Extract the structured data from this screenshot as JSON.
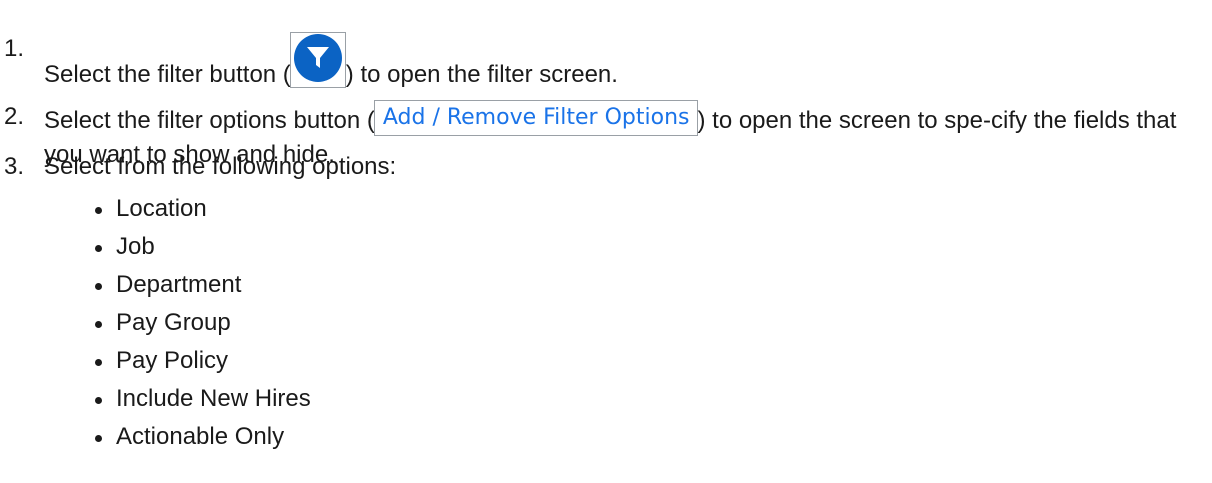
{
  "steps": [
    {
      "number": "1.",
      "before": "Select the filter button (",
      "after": ") to open the filter screen."
    },
    {
      "number": "2.",
      "before": "Select the filter options button (",
      "button_label": "Add / Remove Filter Options",
      "after": ") to open the screen to spe-cify the fields that you want to show and hide."
    },
    {
      "number": "3.",
      "text": "Select from the following options:"
    }
  ],
  "options": [
    "Location",
    "Job",
    "Department",
    "Pay Group",
    "Pay Policy",
    "Include New Hires",
    "Actionable Only"
  ],
  "icons": {
    "filter": "filter-icon",
    "filter_color": "#0b63c4",
    "link_color": "#1a73e8"
  }
}
